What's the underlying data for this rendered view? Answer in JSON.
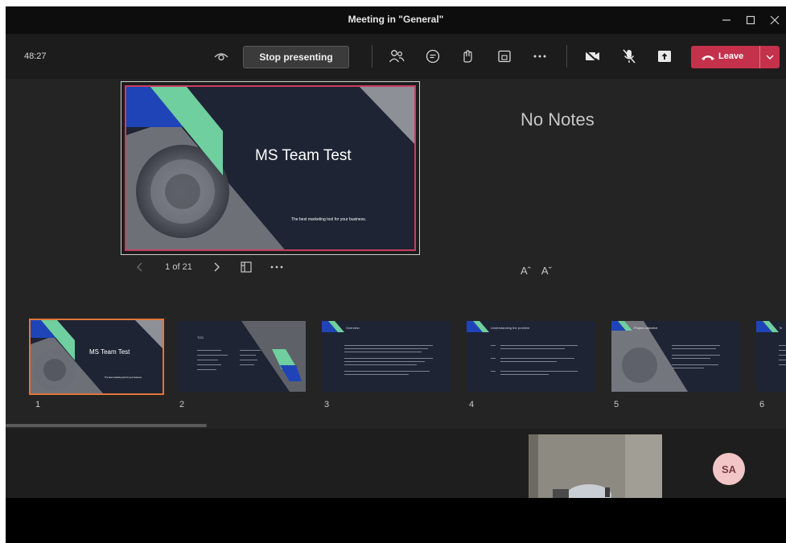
{
  "window": {
    "title": "Meeting in \"General\""
  },
  "toolbar": {
    "timer": "48:27",
    "stop_presenting_label": "Stop presenting",
    "leave_label": "Leave"
  },
  "presenter": {
    "slide_title": "MS Team Test",
    "slide_subtitle": "The best marketing tool for your business.",
    "page_indicator": "1 of 21",
    "notes_text": "No Notes",
    "font_increase": "Aˆ",
    "font_decrease": "Aˇ"
  },
  "thumbnails": [
    {
      "number": "1",
      "title": "MS Team Test",
      "subtitle": "The best marketing tool for your business."
    },
    {
      "number": "2",
      "title": "TOC"
    },
    {
      "number": "3",
      "title": "Overview"
    },
    {
      "number": "4",
      "title": "Understanding the problem"
    },
    {
      "number": "5",
      "title": "Project objective"
    },
    {
      "number": "6",
      "title": "Te"
    }
  ],
  "participants": {
    "avatar_initials": "SA"
  },
  "colors": {
    "leave": "#c4314b",
    "active_thumb_border": "#e0763b",
    "slide_accent_blue": "#1f44b8",
    "slide_accent_green": "#6fcf9f",
    "slide_border": "#c64060"
  }
}
